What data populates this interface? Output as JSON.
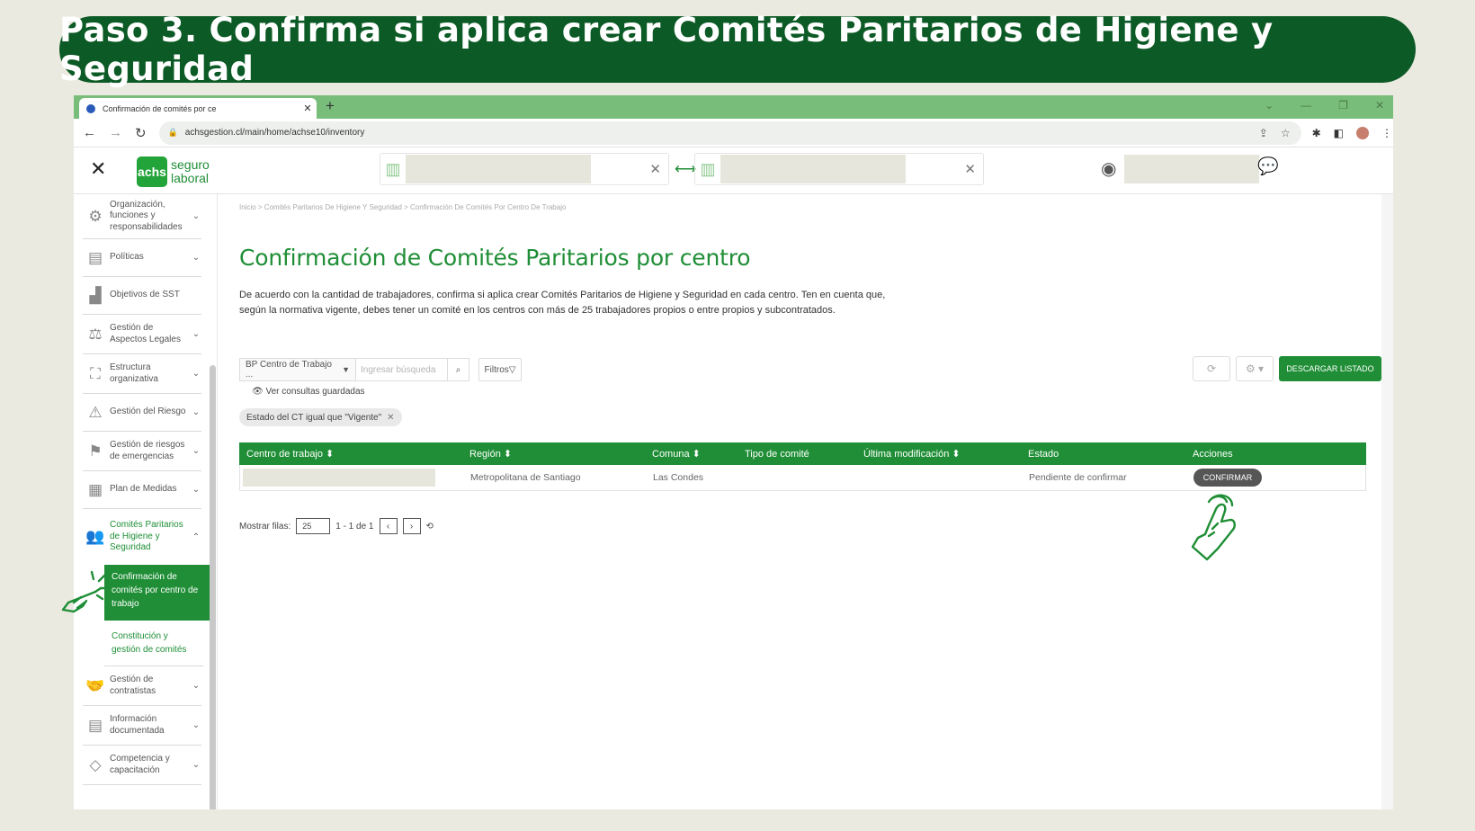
{
  "banner": {
    "title": "Paso 3. Confirma si aplica crear Comités Paritarios de Higiene y Seguridad"
  },
  "browser": {
    "tab_title": "Confirmación de comités por ce",
    "new_tab": "+",
    "url": "achsgestion.cl/main/home/achse10/inventory",
    "window_controls": [
      "⌄",
      "—",
      "❐",
      "✕"
    ]
  },
  "header": {
    "logo_badge": "achs",
    "logo_line1": "seguro",
    "logo_line2": "laboral"
  },
  "sidebar": {
    "items": [
      {
        "label": "Organización, funciones y responsabilidades",
        "icon": "org-icon"
      },
      {
        "label": "Políticas",
        "icon": "document-icon"
      },
      {
        "label": "Objetivos de SST",
        "icon": "chart-icon"
      },
      {
        "label": "Gestión de Aspectos Legales",
        "icon": "scale-icon"
      },
      {
        "label": "Estructura organizativa",
        "icon": "structure-icon"
      },
      {
        "label": "Gestión del Riesgo",
        "icon": "warning-icon"
      },
      {
        "label": "Gestión de riesgos de emergencias",
        "icon": "siren-icon"
      },
      {
        "label": "Plan de Medidas",
        "icon": "clipboard-icon"
      },
      {
        "label": "Comités Paritarios de Higiene y Seguridad",
        "icon": "people-icon"
      }
    ],
    "sub_active": "Confirmación de comités por centro de trabajo",
    "sub_other": "Constitución y gestión de comités",
    "items_after": [
      {
        "label": "Gestión de contratistas",
        "icon": "handshake-icon"
      },
      {
        "label": "Información documentada",
        "icon": "document-icon"
      },
      {
        "label": "Competencia y capacitación",
        "icon": "graduation-icon"
      }
    ]
  },
  "main": {
    "breadcrumb": "Inicio > Comités Paritarios De Higiene Y Seguridad > Confirmación De Comités Por Centro De Trabajo",
    "title": "Confirmación de Comités Paritarios por centro",
    "description": "De acuerdo con la cantidad de trabajadores, confirma si aplica crear Comités Paritarios de Higiene y Seguridad en cada centro. Ten en cuenta que, según la normativa vigente, debes tener un comité en los centros con más de 25 trabajadores propios o entre propios y subcontratados.",
    "filter_select": "BP Centro de Trabajo ...",
    "search_placeholder": "Ingresar búsqueda",
    "filters_btn": "Filtros",
    "saved_queries": "Ver consultas guardadas",
    "chip": "Estado del CT igual que \"Vigente\"",
    "download_btn": "DESCARGAR LISTADO"
  },
  "table": {
    "headers": [
      "Centro de trabajo ⬍",
      "Región ⬍",
      "Comuna ⬍",
      "Tipo de comité",
      "Última modificación ⬍",
      "Estado",
      "Acciones"
    ],
    "row": {
      "region": "Metropolitana de Santiago",
      "comuna": "Las Condes",
      "tipo": "",
      "ultima": "",
      "estado": "Pendiente de confirmar",
      "action": "CONFIRMAR"
    }
  },
  "pagination": {
    "label": "Mostrar filas:",
    "rows": "25",
    "range": "1 - 1 de 1",
    "prev": "‹",
    "next": "›"
  },
  "colors": {
    "accent": "#1f8e36",
    "banner": "#0c5a25",
    "tabbar": "#79bd7a"
  }
}
